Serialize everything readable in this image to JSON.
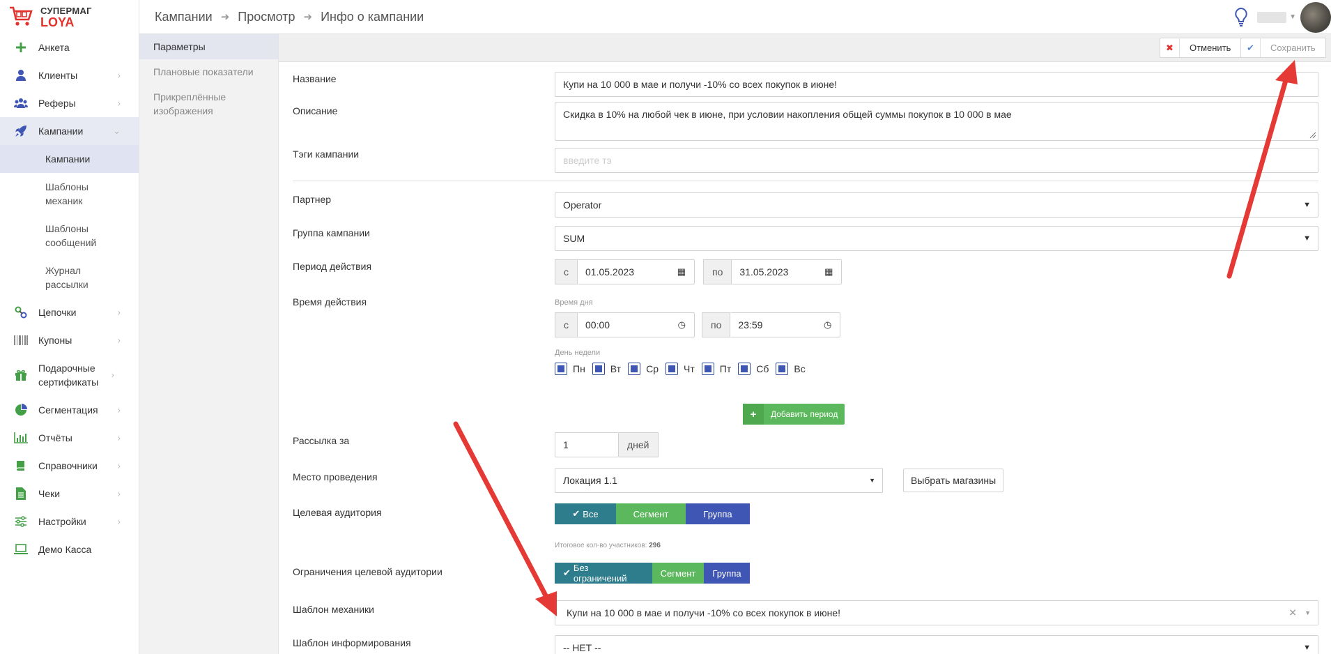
{
  "brand": {
    "line1": "СУПЕРМАГ",
    "line2": "LOYA"
  },
  "sidebar": {
    "items": [
      {
        "label": "Анкета",
        "icon": "plus-icon",
        "chevron": false
      },
      {
        "label": "Клиенты",
        "icon": "user-icon",
        "chevron": true
      },
      {
        "label": "Реферы",
        "icon": "users-icon",
        "chevron": true
      },
      {
        "label": "Кампании",
        "icon": "rocket-icon",
        "chevron": true,
        "expanded": true
      },
      {
        "label": "Цепочки",
        "icon": "link-icon",
        "chevron": true
      },
      {
        "label": "Купоны",
        "icon": "barcode-icon",
        "chevron": true
      },
      {
        "label": "Подарочные сертификаты",
        "icon": "gift-icon",
        "chevron": true
      },
      {
        "label": "Сегментация",
        "icon": "pie-icon",
        "chevron": true
      },
      {
        "label": "Отчёты",
        "icon": "bar-chart-icon",
        "chevron": true
      },
      {
        "label": "Справочники",
        "icon": "book-icon",
        "chevron": true
      },
      {
        "label": "Чеки",
        "icon": "file-icon",
        "chevron": true
      },
      {
        "label": "Настройки",
        "icon": "sliders-icon",
        "chevron": true
      },
      {
        "label": "Демо Касса",
        "icon": "laptop-icon",
        "chevron": false
      }
    ],
    "campaign_sub": [
      "Кампании",
      "Шаблоны механик",
      "Шаблоны сообщений",
      "Журнал рассылки"
    ]
  },
  "breadcrumbs": [
    "Кампании",
    "Просмотр",
    "Инфо о кампании"
  ],
  "subnav": [
    "Параметры",
    "Плановые показатели",
    "Прикреплённые изображения"
  ],
  "toolbar": {
    "cancel": "Отменить",
    "save": "Сохранить"
  },
  "form": {
    "name_label": "Название",
    "name_value": "Купи на 10 000 в мае и получи -10% со всех покупок в июне!",
    "desc_label": "Описание",
    "desc_value": "Скидка в 10% на любой чек в июне, при условии накопления общей суммы покупок в 10 000 в мае",
    "tags_label": "Тэги кампании",
    "tags_placeholder": "введите тэ",
    "partner_label": "Партнер",
    "partner_value": "Operator",
    "group_label": "Группа кампании",
    "group_value": "SUM",
    "period_label": "Период действия",
    "from": "с",
    "to": "по",
    "date_from": "01.05.2023",
    "date_to": "31.05.2023",
    "time_label": "Время действия",
    "day_time": "Время дня",
    "time_from": "00:00",
    "time_to": "23:59",
    "weekday_label": "День недели",
    "weekdays": [
      "Пн",
      "Вт",
      "Ср",
      "Чт",
      "Пт",
      "Сб",
      "Вс"
    ],
    "add_period": "Добавить период",
    "mailing_label": "Рассылка за",
    "mailing_value": "1",
    "mailing_unit": "дней",
    "place_label": "Место проведения",
    "place_value": "Локация 1.1",
    "choose_stores": "Выбрать магазины",
    "audience_label": "Целевая аудитория",
    "aud_all": "Все",
    "aud_segment": "Сегмент",
    "aud_group": "Группа",
    "total_label": "Итоговое кол-во участников:",
    "total_value": "296",
    "restrict_label": "Ограничения целевой аудитории",
    "restrict_none": "Без ограничений",
    "restrict_segment": "Сегмент",
    "restrict_group": "Группа",
    "mech_label": "Шаблон механики",
    "mech_value": "Купи на 10 000 в мае и получи -10% со всех покупок в июне!",
    "inform_label": "Шаблон информирования",
    "inform_value": "-- НЕТ --"
  },
  "colors": {
    "accent": "#3f56b5",
    "teal": "#2e7d8c",
    "green": "#5cb85c",
    "brand_red": "#e2322d",
    "arrow": "#e53935"
  }
}
